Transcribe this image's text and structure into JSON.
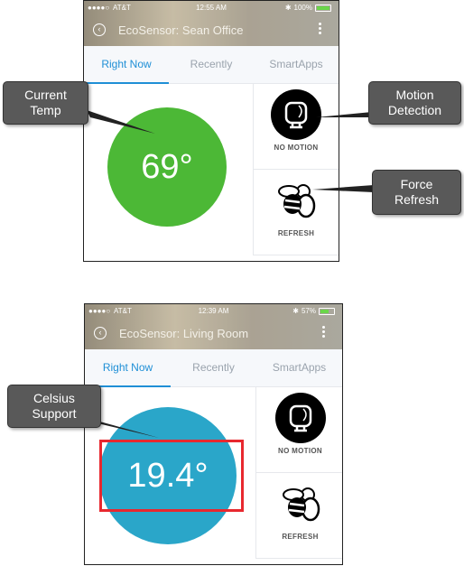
{
  "screens": [
    {
      "status": {
        "carrier": "AT&T",
        "time": "12:55 AM",
        "battery": "100%",
        "battery_level": 1.0
      },
      "device_title": "EcoSensor: Sean Office",
      "tabs": [
        "Right Now",
        "Recently",
        "SmartApps"
      ],
      "temperature": "69°",
      "temperature_color": "#4cb836",
      "motion_label": "NO MOTION",
      "refresh_label": "REFRESH"
    },
    {
      "status": {
        "carrier": "AT&T",
        "time": "12:39 AM",
        "battery": "57%",
        "battery_level": 0.57
      },
      "device_title": "EcoSensor: Living Room",
      "tabs": [
        "Right Now",
        "Recently",
        "SmartApps"
      ],
      "temperature": "19.4°",
      "temperature_color": "#2aa6c9",
      "motion_label": "NO MOTION",
      "refresh_label": "REFRESH"
    }
  ],
  "callouts": {
    "current_temp": "Current\nTemp",
    "motion_detection": "Motion\nDetection",
    "force_refresh": "Force\nRefresh",
    "celsius_support": "Celsius\nSupport"
  },
  "icons": {
    "back": "back-arrow-icon",
    "menu": "kebab-menu-icon",
    "motion": "motion-sensor-icon",
    "refresh": "bee-refresh-icon"
  },
  "colors": {
    "active_tab": "#1f8fd6",
    "highlight_box": "#e8282f",
    "callout_bg": "#595959"
  }
}
